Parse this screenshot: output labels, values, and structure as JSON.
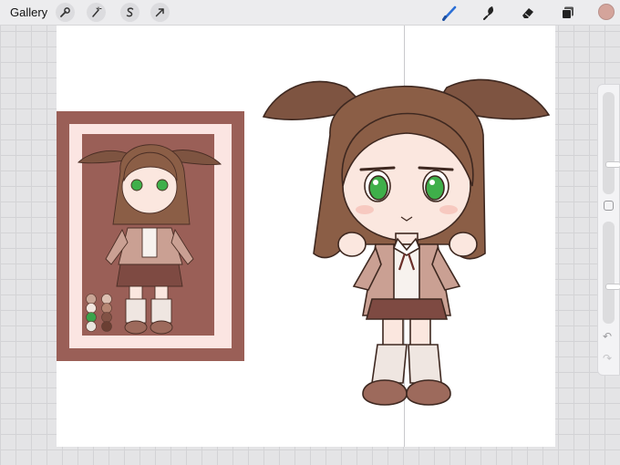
{
  "toolbar": {
    "gallery_label": "Gallery",
    "left_tools": [
      "wrench-icon",
      "magic-wand-icon",
      "selection-icon",
      "transform-arrow-icon"
    ],
    "right_tools": [
      "brush-icon",
      "smudge-icon",
      "eraser-icon",
      "layers-icon"
    ],
    "active_tool": "brush",
    "active_tool_color": "#2b6fd6",
    "current_color": "#d4a49b"
  },
  "sidebar": {
    "brush_size_level": 0.28,
    "opacity_level": 0.35,
    "undo_icon": "undo-icon",
    "redo_icon": "redo-icon"
  },
  "artwork": {
    "frame_color": "#9a5f57",
    "mat_color": "#fbe5e2",
    "hair_color": "#8b5e46",
    "ears_color": "#7e5441",
    "skin_color": "#fbe7df",
    "eye_color": "#3faf4a",
    "cardigan_color": "#caa093",
    "skirt_color": "#7e4a42",
    "sock_color": "#efe6e1",
    "shoe_color": "#9d6a5c",
    "palette_swatches": [
      "#c9a596",
      "#dcc0b2",
      "#f2e6df",
      "#b58572",
      "#3aa34b",
      "#825245",
      "#e9e4dd",
      "#6b3f33"
    ]
  }
}
